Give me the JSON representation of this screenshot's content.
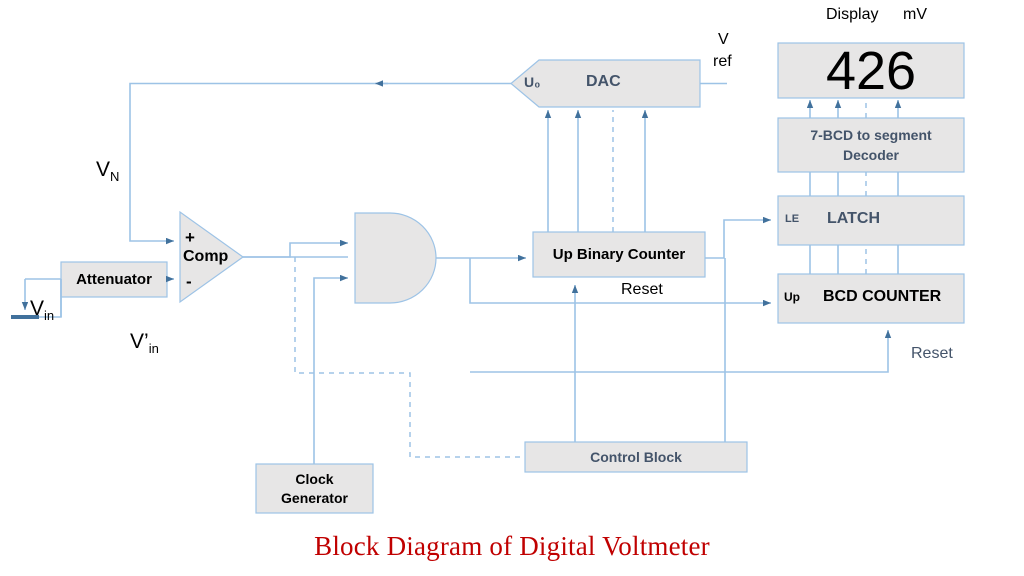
{
  "title": "Block Diagram of Digital Voltmeter",
  "colors": {
    "block_fill": "#e7e6e6",
    "block_stroke": "#9dc3e6",
    "wire": "#9dc3e6",
    "arrow": "#41719c",
    "title_red": "#c00000",
    "text_gray_blue": "#44546a",
    "text_black": "#000000"
  },
  "blocks": {
    "attenuator": {
      "label": "Attenuator"
    },
    "comparator": {
      "label": "Comp",
      "plus": "+",
      "minus": "-"
    },
    "and_gate": {
      "label": ""
    },
    "clock_generator": {
      "line1": "Clock",
      "line2": "Generator"
    },
    "up_binary_counter": {
      "label": "Up Binary Counter"
    },
    "control_block": {
      "label": "Control Block"
    },
    "dac": {
      "label": "DAC",
      "input_label": "U₀"
    },
    "latch": {
      "label": "LATCH",
      "enable_label": "LE"
    },
    "bcd_counter": {
      "label": "BCD COUNTER",
      "up_label": "Up"
    },
    "decoder": {
      "line1": "7-BCD to segment",
      "line2": "Decoder"
    },
    "display": {
      "value": "426"
    }
  },
  "labels": {
    "v_in": {
      "base": "V",
      "sub": "in"
    },
    "v_in_prime": {
      "base": "V’",
      "sub": "in"
    },
    "v_n": {
      "base": "V",
      "sub": "N"
    },
    "v_ref_line1": "V",
    "v_ref_line2": "ref",
    "display_caption": "Display",
    "unit": "mV",
    "reset_left": "Reset",
    "reset_right": "Reset"
  }
}
